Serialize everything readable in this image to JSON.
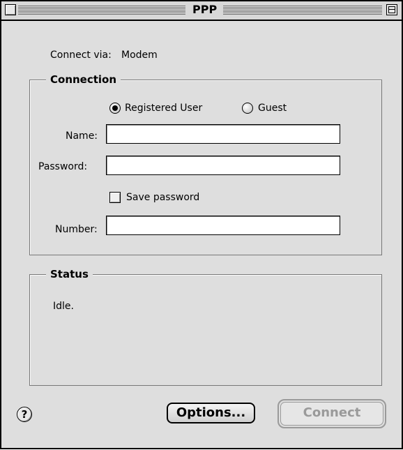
{
  "window": {
    "title": "PPP"
  },
  "connect_via": {
    "label": "Connect via:",
    "value": "Modem"
  },
  "connection": {
    "legend": "Connection",
    "radio_registered": {
      "label": "Registered User",
      "selected": true
    },
    "radio_guest": {
      "label": "Guest",
      "selected": false
    },
    "name": {
      "label": "Name:",
      "value": ""
    },
    "password": {
      "label": "Password:",
      "value": ""
    },
    "save_password": {
      "label": "Save password",
      "checked": false
    },
    "number": {
      "label": "Number:",
      "value": ""
    }
  },
  "status": {
    "legend": "Status",
    "text": "Idle."
  },
  "buttons": {
    "options": "Options...",
    "connect": "Connect",
    "help": "?"
  }
}
